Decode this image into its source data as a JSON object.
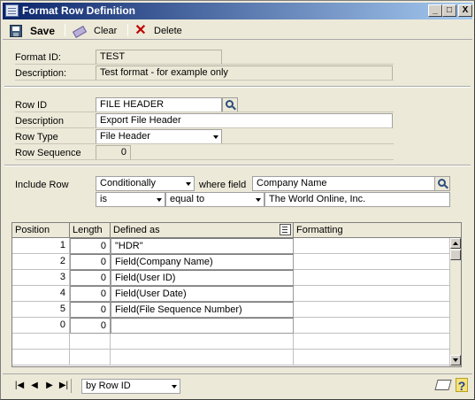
{
  "window": {
    "title": "Format Row Definition",
    "controls": {
      "minimize": "_",
      "maximize": "□",
      "close": "X"
    }
  },
  "toolbar": {
    "save_label": "Save",
    "clear_label": "Clear",
    "delete_label": "Delete",
    "save_icon": "floppy-disk-icon",
    "clear_icon": "eraser-icon",
    "delete_icon": "red-x-icon"
  },
  "header": {
    "format_id_label": "Format ID:",
    "format_id_value": "TEST",
    "description_label": "Description:",
    "description_value": "Test format - for example only"
  },
  "row": {
    "row_id_label": "Row ID",
    "row_id_value": "FILE HEADER",
    "description_label": "Description",
    "description_value": "Export File Header",
    "row_type_label": "Row Type",
    "row_type_value": "File Header",
    "row_sequence_label": "Row Sequence",
    "row_sequence_value": "0"
  },
  "include": {
    "label": "Include Row",
    "condition_value": "Conditionally",
    "where_field_label": "where field",
    "field_value": "Company Name",
    "operator_is": "is",
    "comparison": "equal to",
    "compare_value": "The World Online, Inc."
  },
  "grid": {
    "columns": [
      "Position",
      "Length",
      "Defined as",
      "Formatting"
    ],
    "rows": [
      {
        "position": "1",
        "length": "0",
        "defined_as": "\"HDR\"",
        "formatting": ""
      },
      {
        "position": "2",
        "length": "0",
        "defined_as": "Field(Company Name)",
        "formatting": ""
      },
      {
        "position": "3",
        "length": "0",
        "defined_as": "Field(User ID)",
        "formatting": ""
      },
      {
        "position": "4",
        "length": "0",
        "defined_as": "Field(User Date)",
        "formatting": ""
      },
      {
        "position": "5",
        "length": "0",
        "defined_as": "Field(File Sequence Number)",
        "formatting": ""
      },
      {
        "position": "0",
        "length": "0",
        "defined_as": "",
        "formatting": ""
      },
      {
        "position": "",
        "length": "",
        "defined_as": "",
        "formatting": ""
      },
      {
        "position": "",
        "length": "",
        "defined_as": "",
        "formatting": ""
      }
    ]
  },
  "footer": {
    "nav": {
      "first": "|◀",
      "prev": "◀",
      "next": "▶",
      "last": "▶|"
    },
    "sort_value": "by Row ID"
  }
}
